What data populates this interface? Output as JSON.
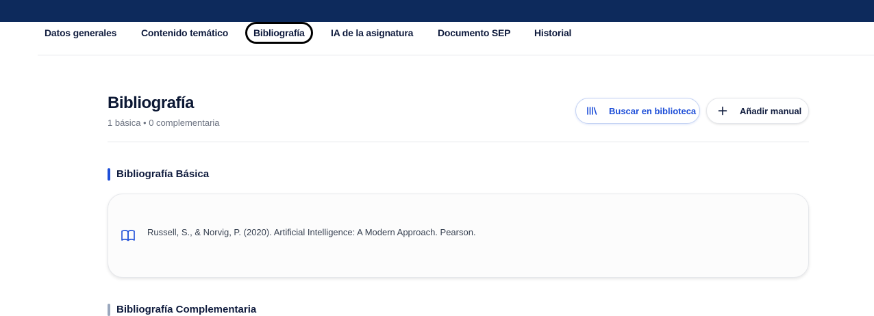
{
  "tabs": [
    {
      "label": "Datos generales"
    },
    {
      "label": "Contenido temático"
    },
    {
      "label": "Bibliografía"
    },
    {
      "label": "IA de la asignatura"
    },
    {
      "label": "Documento SEP"
    },
    {
      "label": "Historial"
    }
  ],
  "active_tab": "Bibliografía",
  "header": {
    "title": "Bibliografía",
    "subtitle": "1 básica • 0 complementaria",
    "search_library_label": "Buscar en biblioteca",
    "add_manual_label": "Añadir manual"
  },
  "sections": {
    "basic": {
      "title": "Bibliografía Básica",
      "items": [
        "Russell, S., & Norvig, P. (2020). Artificial Intelligence: A Modern Approach. Pearson."
      ]
    },
    "complementary": {
      "title": "Bibliografía Complementaria"
    }
  },
  "colors": {
    "topbar": "#0d2a5c",
    "accent": "#1d4ed8",
    "text": "#0f1b3d"
  },
  "icons": [
    "library-icon",
    "plus-icon",
    "book-open-icon"
  ]
}
